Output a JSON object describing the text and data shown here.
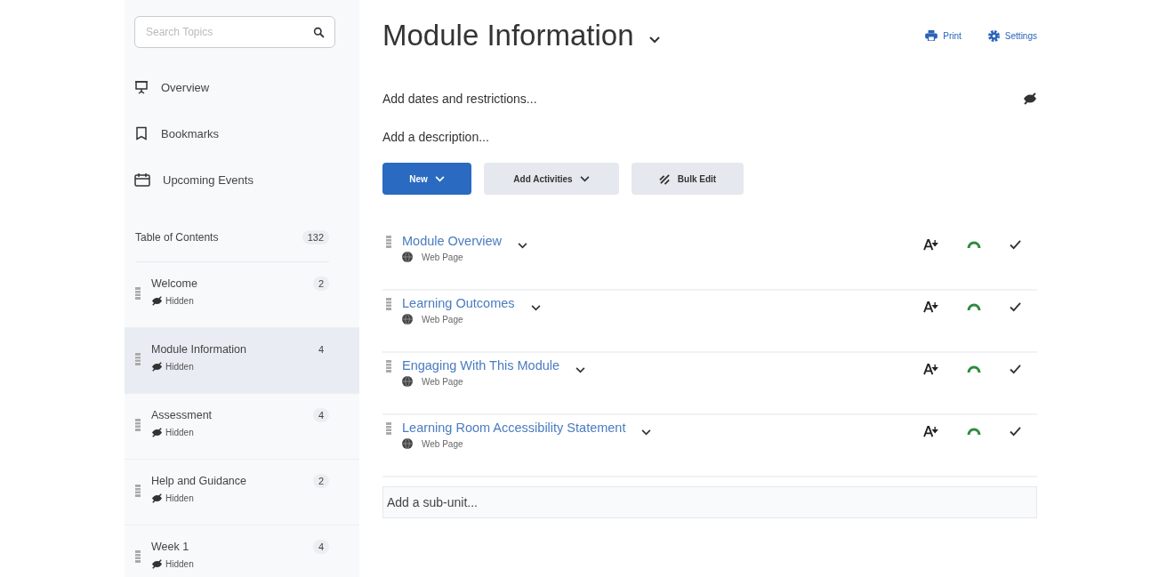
{
  "sidebar": {
    "search": {
      "placeholder": "Search Topics"
    },
    "links": [
      {
        "kind": "overview",
        "label": "Overview"
      },
      {
        "kind": "bookmarks",
        "label": "Bookmarks"
      },
      {
        "kind": "events",
        "label": "Upcoming Events"
      }
    ],
    "toc": {
      "label": "Table of Contents",
      "count": "132"
    },
    "units": [
      {
        "title": "Welcome",
        "count": "2",
        "status": "Hidden",
        "selected": false
      },
      {
        "title": "Module Information",
        "count": "4",
        "status": "Hidden",
        "selected": true
      },
      {
        "title": "Assessment",
        "count": "4",
        "status": "Hidden",
        "selected": false
      },
      {
        "title": "Help and Guidance",
        "count": "2",
        "status": "Hidden",
        "selected": false
      },
      {
        "title": "Week 1",
        "count": "4",
        "status": "Hidden",
        "selected": false
      }
    ]
  },
  "main": {
    "title": "Module Information",
    "actions": [
      {
        "kind": "print",
        "label": "Print"
      },
      {
        "kind": "settings",
        "label": "Settings"
      }
    ],
    "dates_link": "Add dates and restrictions...",
    "description_link": "Add a description...",
    "buttons": [
      {
        "kind": "primary",
        "label": "New"
      },
      {
        "kind": "menu",
        "label": "Add Activities"
      },
      {
        "kind": "bulk",
        "label": "Bulk Edit"
      }
    ],
    "topics": [
      {
        "title": "Module Overview",
        "type": "Web Page",
        "completed": true
      },
      {
        "title": "Learning Outcomes",
        "type": "Web Page",
        "completed": true
      },
      {
        "title": "Engaging With This Module",
        "type": "Web Page",
        "completed": true
      },
      {
        "title": "Learning Room Accessibility Statement",
        "type": "Web Page",
        "completed": true
      }
    ],
    "subunit": {
      "placeholder": "Add a sub-unit..."
    }
  }
}
